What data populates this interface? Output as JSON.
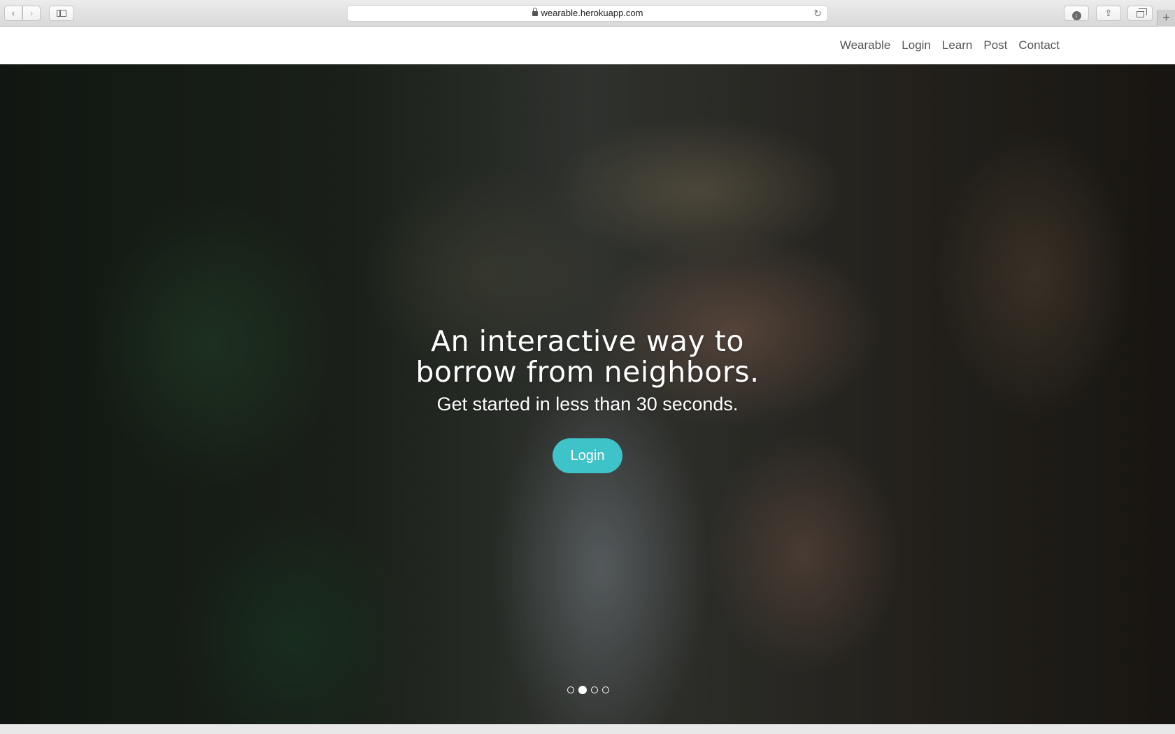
{
  "browser": {
    "url": "wearable.herokuapp.com",
    "back_label": "‹",
    "forward_label": "›",
    "reload_label": "↻",
    "download_label": "↓",
    "share_label": "⇪",
    "newtab_label": "+"
  },
  "nav": {
    "items": [
      "Wearable",
      "Login",
      "Learn",
      "Post",
      "Contact"
    ]
  },
  "hero": {
    "headline": "An interactive way to borrow from neighbors.",
    "subline": "Get started in less than 30 seconds.",
    "cta_label": "Login",
    "cta_color": "#3ec3c9",
    "carousel": {
      "total": 4,
      "active_index": 1
    }
  }
}
